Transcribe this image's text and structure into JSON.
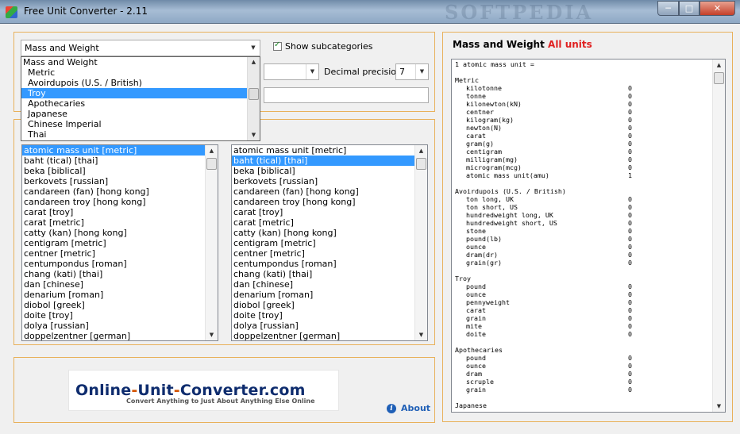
{
  "window": {
    "title": "Free Unit Converter - 2.11",
    "watermark": "SOFTPEDIA",
    "min_label": "─",
    "max_label": "□",
    "close_label": "✕"
  },
  "controls": {
    "category_value": "Mass and Weight",
    "show_subcategories_label": "Show subcategories",
    "decimal_precision_label": "Decimal precision:",
    "decimal_precision_value": "7"
  },
  "dropdown": {
    "items": [
      {
        "label": "Mass and Weight",
        "selected": false,
        "sub": false
      },
      {
        "label": "Metric",
        "selected": false,
        "sub": true
      },
      {
        "label": "Avoirdupois (U.S. / British)",
        "selected": false,
        "sub": true
      },
      {
        "label": "Troy",
        "selected": true,
        "sub": true
      },
      {
        "label": "Apothecaries",
        "selected": false,
        "sub": true
      },
      {
        "label": "Japanese",
        "selected": false,
        "sub": true
      },
      {
        "label": "Chinese Imperial",
        "selected": false,
        "sub": true
      },
      {
        "label": "Thai",
        "selected": false,
        "sub": true
      }
    ]
  },
  "lists": {
    "left": {
      "selected_index": 0,
      "items": [
        "atomic mass unit [metric]",
        "baht (tical) [thai]",
        "beka [biblical]",
        "berkovets [russian]",
        "candareen (fan) [hong kong]",
        "candareen troy [hong kong]",
        "carat [troy]",
        "carat [metric]",
        "catty (kan) [hong kong]",
        "centigram [metric]",
        "centner [metric]",
        "centumpondus [roman]",
        "chang (kati) [thai]",
        "dan [chinese]",
        "denarium [roman]",
        "diobol [greek]",
        "doite [troy]",
        "dolya [russian]",
        "doppelzentner [german]"
      ]
    },
    "right": {
      "selected_index": 1,
      "items": [
        "atomic mass unit [metric]",
        "baht (tical) [thai]",
        "beka [biblical]",
        "berkovets [russian]",
        "candareen (fan) [hong kong]",
        "candareen troy [hong kong]",
        "carat [troy]",
        "carat [metric]",
        "catty (kan) [hong kong]",
        "centigram [metric]",
        "centner [metric]",
        "centumpondus [roman]",
        "chang (kati) [thai]",
        "dan [chinese]",
        "denarium [roman]",
        "diobol [greek]",
        "doite [troy]",
        "dolya [russian]",
        "doppelzentner [german]"
      ]
    }
  },
  "logo": {
    "part1": "Online",
    "dash": "-",
    "part2": "Unit",
    "part3": "Converter.com",
    "tagline": "Convert Anything to Just About Anything Else Online"
  },
  "about_label": "About",
  "results": {
    "title": "Mass and Weight",
    "title_accent": "All units",
    "lines": [
      {
        "kind": "header",
        "text": "1 atomic mass unit ="
      },
      {
        "kind": "gap"
      },
      {
        "kind": "header",
        "text": "Metric"
      },
      {
        "kind": "row",
        "unit": "kilotonne",
        "value": "0"
      },
      {
        "kind": "row",
        "unit": "tonne",
        "value": "0"
      },
      {
        "kind": "row",
        "unit": "kilonewton(kN)",
        "value": "0"
      },
      {
        "kind": "row",
        "unit": "centner",
        "value": "0"
      },
      {
        "kind": "row",
        "unit": "kilogram(kg)",
        "value": "0"
      },
      {
        "kind": "row",
        "unit": "newton(N)",
        "value": "0"
      },
      {
        "kind": "row",
        "unit": "carat",
        "value": "0"
      },
      {
        "kind": "row",
        "unit": "gram(g)",
        "value": "0"
      },
      {
        "kind": "row",
        "unit": "centigram",
        "value": "0"
      },
      {
        "kind": "row",
        "unit": "milligram(mg)",
        "value": "0"
      },
      {
        "kind": "row",
        "unit": "microgram(mcg)",
        "value": "0"
      },
      {
        "kind": "row",
        "unit": "atomic mass unit(amu)",
        "value": "1"
      },
      {
        "kind": "gap"
      },
      {
        "kind": "header",
        "text": "Avoirdupois (U.S. / British)"
      },
      {
        "kind": "row",
        "unit": "ton long, UK",
        "value": "0"
      },
      {
        "kind": "row",
        "unit": "ton short, US",
        "value": "0"
      },
      {
        "kind": "row",
        "unit": "hundredweight long, UK",
        "value": "0"
      },
      {
        "kind": "row",
        "unit": "hundredweight short, US",
        "value": "0"
      },
      {
        "kind": "row",
        "unit": "stone",
        "value": "0"
      },
      {
        "kind": "row",
        "unit": "pound(lb)",
        "value": "0"
      },
      {
        "kind": "row",
        "unit": "ounce",
        "value": "0"
      },
      {
        "kind": "row",
        "unit": "dram(dr)",
        "value": "0"
      },
      {
        "kind": "row",
        "unit": "grain(gr)",
        "value": "0"
      },
      {
        "kind": "gap"
      },
      {
        "kind": "header",
        "text": "Troy"
      },
      {
        "kind": "row",
        "unit": "pound",
        "value": "0"
      },
      {
        "kind": "row",
        "unit": "ounce",
        "value": "0"
      },
      {
        "kind": "row",
        "unit": "pennyweight",
        "value": "0"
      },
      {
        "kind": "row",
        "unit": "carat",
        "value": "0"
      },
      {
        "kind": "row",
        "unit": "grain",
        "value": "0"
      },
      {
        "kind": "row",
        "unit": "mite",
        "value": "0"
      },
      {
        "kind": "row",
        "unit": "doite",
        "value": "0"
      },
      {
        "kind": "gap"
      },
      {
        "kind": "header",
        "text": "Apothecaries"
      },
      {
        "kind": "row",
        "unit": "pound",
        "value": "0"
      },
      {
        "kind": "row",
        "unit": "ounce",
        "value": "0"
      },
      {
        "kind": "row",
        "unit": "dram",
        "value": "0"
      },
      {
        "kind": "row",
        "unit": "scruple",
        "value": "0"
      },
      {
        "kind": "row",
        "unit": "grain",
        "value": "0"
      },
      {
        "kind": "gap"
      },
      {
        "kind": "header",
        "text": "Japanese"
      }
    ]
  },
  "colors": {
    "panel_border": "#e8b15b",
    "selection": "#3399ff",
    "accent_red": "#e02020",
    "link_blue": "#1f5fb6"
  }
}
